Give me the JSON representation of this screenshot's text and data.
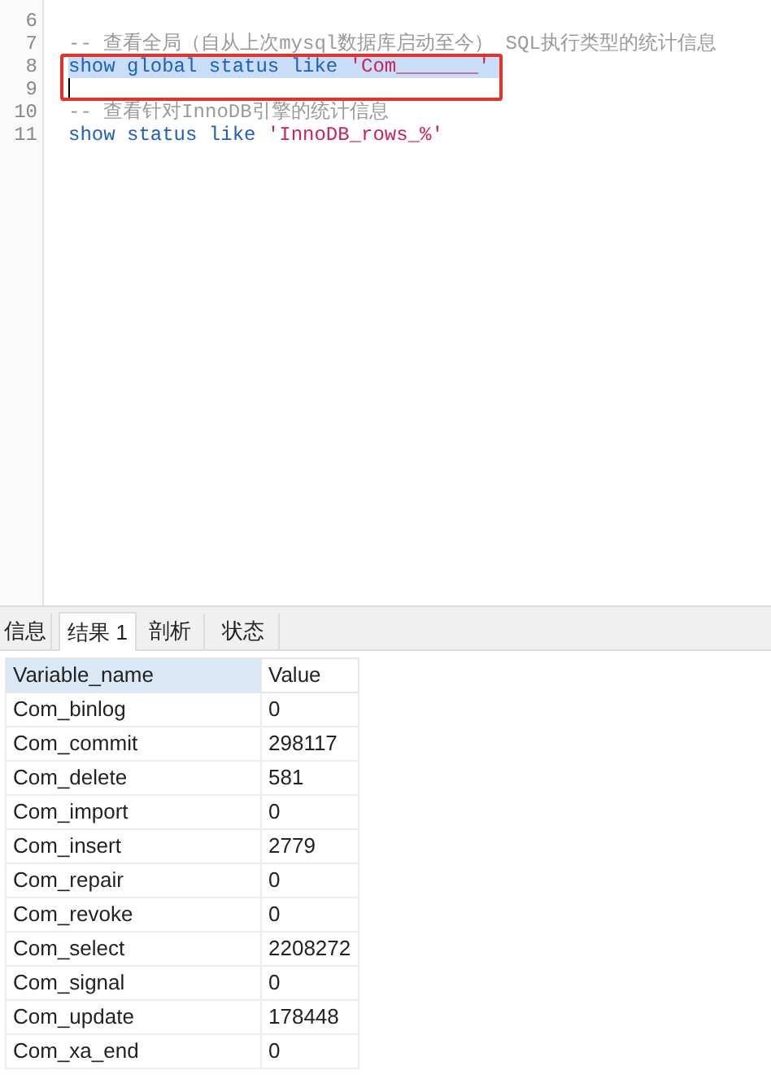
{
  "editor": {
    "lines": [
      {
        "number": "6",
        "selected": false,
        "cursor": false
      },
      {
        "number": "7",
        "selected": false,
        "cursor": false,
        "tokens": [
          {
            "kind": "comment",
            "text": "-- 查看全局（自从上次mysql数据库启动至今） SQL执行类型的统计信息"
          }
        ]
      },
      {
        "number": "8",
        "selected": true,
        "cursor": false,
        "tokens": [
          {
            "kind": "keyword",
            "text": "show global status like "
          },
          {
            "kind": "string",
            "text": "'Com_______'"
          }
        ]
      },
      {
        "number": "9",
        "selected": false,
        "cursor": true
      },
      {
        "number": "10",
        "selected": false,
        "cursor": false,
        "tokens": [
          {
            "kind": "comment",
            "text": "-- 查看针对InnoDB引擎的统计信息"
          }
        ]
      },
      {
        "number": "11",
        "selected": false,
        "cursor": false,
        "tokens": [
          {
            "kind": "keyword",
            "text": "show status like "
          },
          {
            "kind": "string",
            "text": "'InnoDB_rows_%'"
          }
        ]
      }
    ]
  },
  "tabs": [
    {
      "label": "信息",
      "selected": false
    },
    {
      "label": "结果 1",
      "selected": true
    },
    {
      "label": "剖析",
      "selected": false
    },
    {
      "label": "状态",
      "selected": false
    }
  ],
  "table": {
    "columns": [
      "Variable_name",
      "Value"
    ],
    "rows": [
      [
        "Com_binlog",
        "0"
      ],
      [
        "Com_commit",
        "298117"
      ],
      [
        "Com_delete",
        "581"
      ],
      [
        "Com_import",
        "0"
      ],
      [
        "Com_insert",
        "2779"
      ],
      [
        "Com_repair",
        "0"
      ],
      [
        "Com_revoke",
        "0"
      ],
      [
        "Com_select",
        "2208272"
      ],
      [
        "Com_signal",
        "0"
      ],
      [
        "Com_update",
        "178448"
      ],
      [
        "Com_xa_end",
        "0"
      ]
    ]
  }
}
